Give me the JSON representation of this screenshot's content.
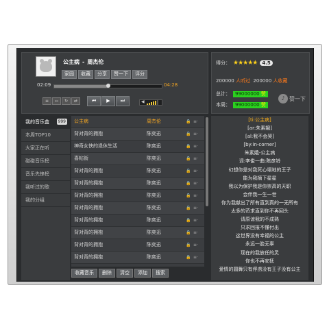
{
  "player": {
    "song": "公主病",
    "separator": "-",
    "artist": "周杰伦",
    "actions": [
      "家园",
      "收藏",
      "分享",
      "赞一下",
      "评分"
    ],
    "current_time": "02:09",
    "total_time": "04:28",
    "progress_fraction": 0.5,
    "volume_level_fraction": 0.8
  },
  "score": {
    "label": "得分：",
    "stars": "★★★★★",
    "rating": "4.5",
    "listened_count": "200000",
    "listened_label": "人听过",
    "fav_count": "200000",
    "fav_label": "人收藏",
    "total_label": "总计：",
    "total_value": "99000000",
    "total_unit": "赞",
    "week_label": "本周：",
    "week_value": "99000000",
    "week_unit": "赞",
    "like_label": "赞一下"
  },
  "nav": {
    "items": [
      {
        "label": "我的音乐盒",
        "badge": "999"
      },
      {
        "label": "本周TOP10"
      },
      {
        "label": "大家正在听"
      },
      {
        "label": "碰碰音乐榜"
      },
      {
        "label": "音乐先锋榜"
      },
      {
        "label": "我听过的歌"
      },
      {
        "label": "我的分组"
      }
    ]
  },
  "list": {
    "header": {
      "title": "公主病",
      "artist": "周杰伦"
    },
    "rows": [
      {
        "title": "背对背的拥抱",
        "artist": "陈奕迅"
      },
      {
        "title": "神奇女侠的退休生活",
        "artist": "陈奕迅"
      },
      {
        "title": "喜帖街",
        "artist": "陈奕迅"
      },
      {
        "title": "背对背的拥抱",
        "artist": "陈奕迅"
      },
      {
        "title": "背对背的拥抱",
        "artist": "陈奕迅"
      },
      {
        "title": "背对背的拥抱",
        "artist": "陈奕迅"
      },
      {
        "title": "背对背的拥抱",
        "artist": "陈奕迅"
      },
      {
        "title": "背对背的拥抱",
        "artist": "陈奕迅"
      },
      {
        "title": "背对背的拥抱",
        "artist": "陈奕迅"
      },
      {
        "title": "背对背的拥抱",
        "artist": "陈奕迅"
      },
      {
        "title": "背对背的拥抱",
        "artist": "陈奕迅"
      },
      {
        "title": "背对背的拥抱",
        "artist": "陈奕迅"
      }
    ],
    "toolbar": [
      "收藏音乐",
      "删除",
      "清空",
      "添加",
      "搜索"
    ]
  },
  "lyrics": {
    "lines": [
      "[ti:公主病]",
      "[ar:朱素娥]",
      "[al:我不会哭]",
      "[by:in-corner]",
      "朱素娥-公主病",
      "词:李俊一曲:陈彦铃",
      "幻想你是对我死心塌地的王子",
      "能为我摘下星星",
      "我以为保护我是你崇高的天职",
      "会伴我一生一世",
      "你为我献出了所有直到真的一无所有",
      "太多的苛求直到你不再回头",
      "请原谅我的不成熟",
      "只求回报不懂付出",
      "这世界没有幸福的公主",
      "永远一脸无辜",
      "现在的我放任的灵",
      "你也不再安抚",
      "爱情的圆舞只有俘虏没有王子没有公主"
    ]
  },
  "colors": {
    "accent_orange": "#f4a623",
    "green_badge": "#2bd11f",
    "star": "#ffd21a"
  }
}
